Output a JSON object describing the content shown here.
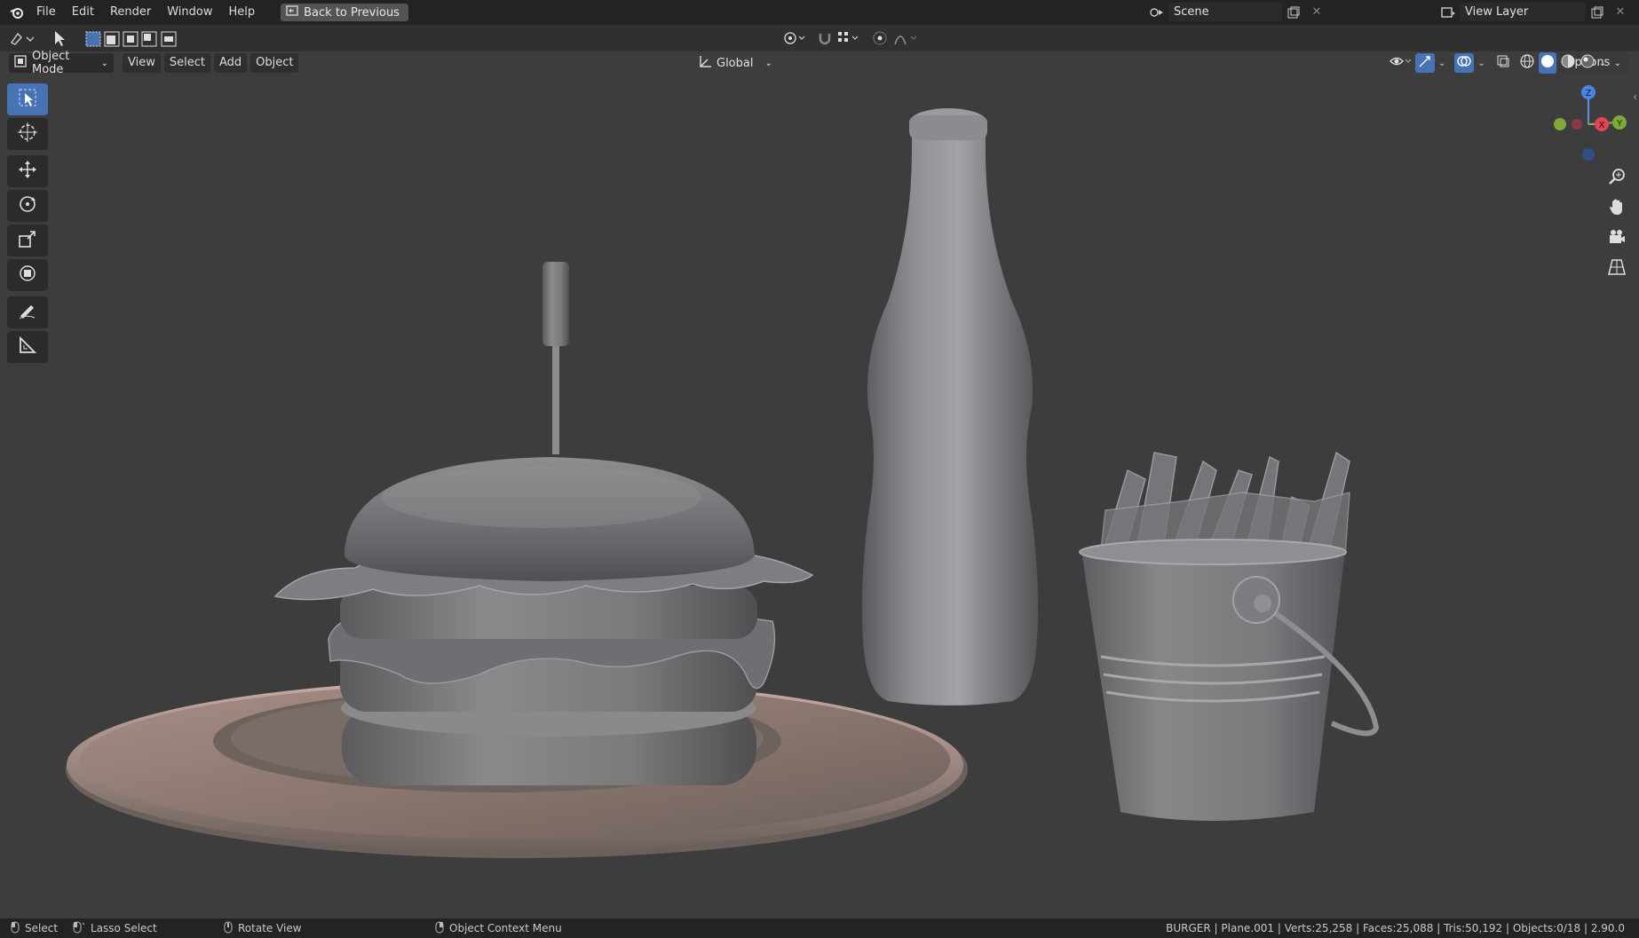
{
  "menu": {
    "file": "File",
    "edit": "Edit",
    "render": "Render",
    "window": "Window",
    "help": "Help",
    "back": "Back to Previous"
  },
  "scene": {
    "name": "Scene"
  },
  "view_layer": {
    "name": "View Layer"
  },
  "toolbar": {
    "transform_orientation": "Global",
    "options": "Options"
  },
  "header": {
    "mode": "Object Mode",
    "view": "View",
    "select": "Select",
    "add": "Add",
    "object": "Object"
  },
  "gizmo": {
    "z": "Z",
    "x": "X",
    "y": "Y"
  },
  "status": {
    "select": "Select",
    "lasso": "Lasso Select",
    "rotate": "Rotate View",
    "context": "Object Context Menu",
    "stats": "BURGER | Plane.001 | Verts:25,258 | Faces:25,088 | Tris:50,192 | Objects:0/18 | 2.90.0"
  },
  "colors": {
    "accent": "#4772b3",
    "topbar": "#232323",
    "viewport": "#3d3d3d"
  }
}
